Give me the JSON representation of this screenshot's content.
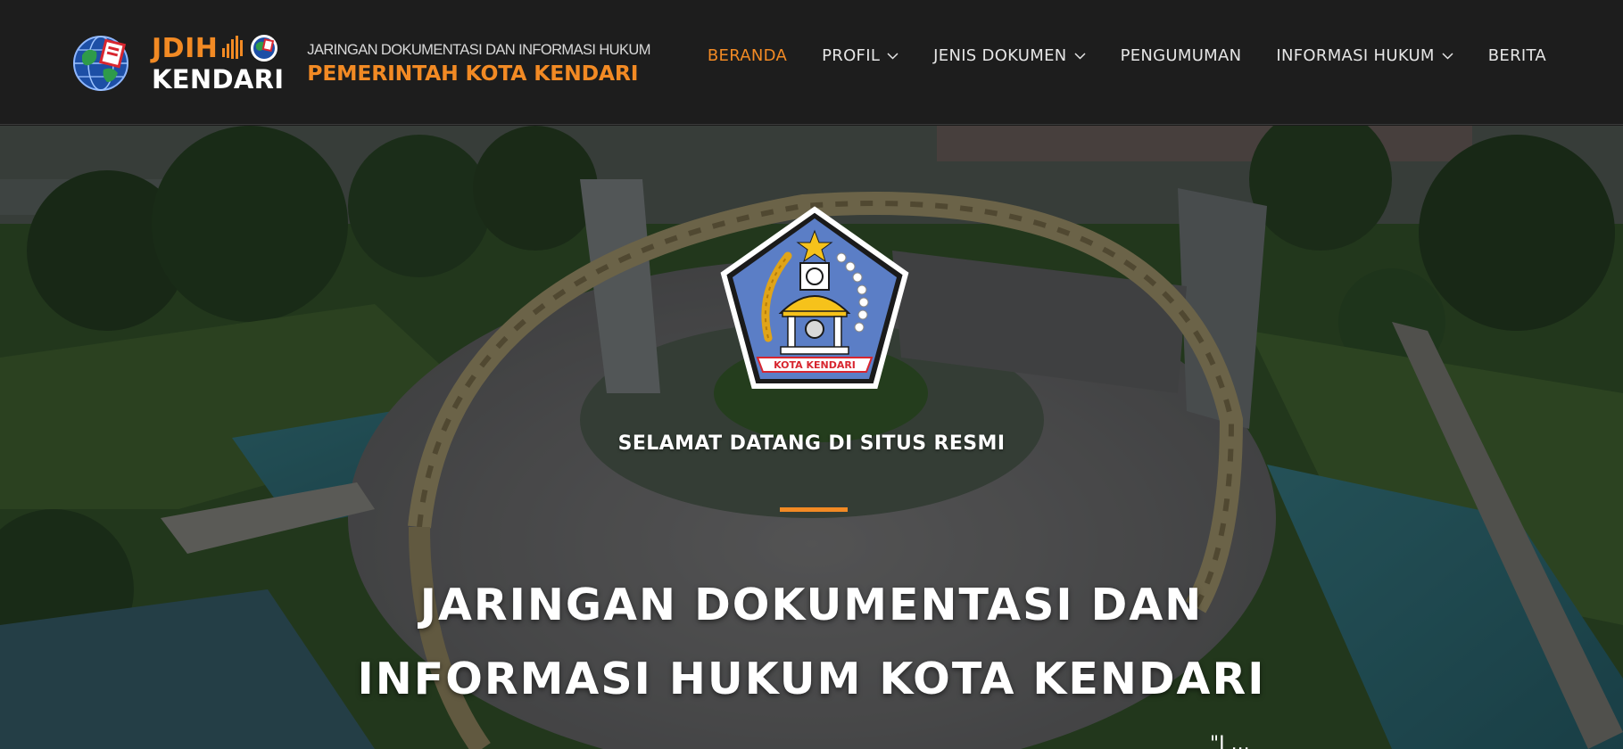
{
  "brand": {
    "jdih": "JDIH",
    "kendari": "KENDARI",
    "gov_sub": "JARINGAN DOKUMENTASI DAN INFORMASI HUKUM",
    "gov_main": "PEMERINTAH KOTA KENDARI"
  },
  "nav": {
    "items": [
      {
        "label": "BERANDA",
        "active": true
      },
      {
        "label": "PROFIL",
        "dropdown": true
      },
      {
        "label": "JENIS DOKUMEN",
        "dropdown": true
      },
      {
        "label": "PENGUMUMAN"
      },
      {
        "label": "INFORMASI HUKUM",
        "dropdown": true
      },
      {
        "label": "BERITA"
      }
    ]
  },
  "hero": {
    "emblem_text": "KOTA KENDARI",
    "welcome": "SELAMAT DATANG DI SITUS RESMI",
    "title_line1": "JARINGAN DOKUMENTASI DAN",
    "title_line2": "INFORMASI HUKUM KOTA KENDARI",
    "partial_text": "\"I ..."
  },
  "colors": {
    "accent": "#f28a24",
    "header_bg": "#1d1d1d",
    "nav_text": "#e6e6e6",
    "emblem_blue": "#5b7ec6",
    "emblem_yellow": "#f6c21b"
  },
  "icons": [
    "globe-logo",
    "bars-icon",
    "mini-globe-icon",
    "chevron-down-icon",
    "city-emblem-logo"
  ]
}
